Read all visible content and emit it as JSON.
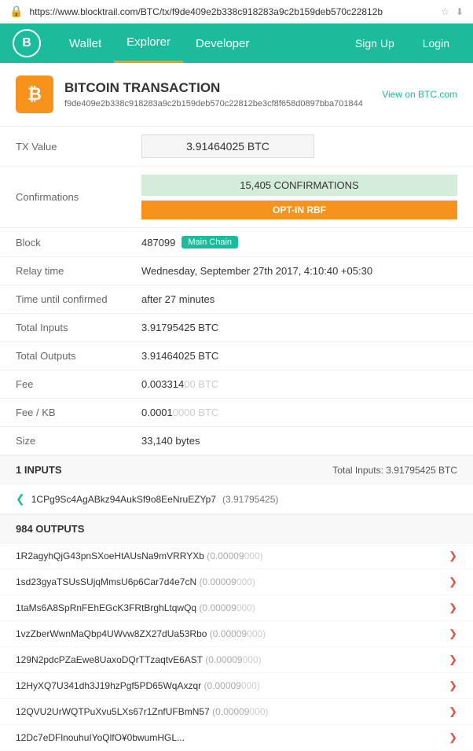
{
  "url": {
    "protocol_icon": "🔒",
    "address": "https://www.blocktrail.com/BTC/tx/f9de409e2b338c918283a9c2b159deb570c22812b"
  },
  "nav": {
    "logo": "B",
    "links": [
      {
        "label": "Wallet",
        "active": false
      },
      {
        "label": "Explorer",
        "active": true
      },
      {
        "label": "Developer",
        "active": false
      }
    ],
    "right_links": [
      {
        "label": "Sign Up"
      },
      {
        "label": "Login"
      }
    ]
  },
  "transaction": {
    "icon": "₿",
    "title": "BITCOIN TRANSACTION",
    "view_link_label": "View on BTC.com",
    "hash": "f9de409e2b338c918283a9c2b159deb570c22812be3cf8f658d0897bba701844"
  },
  "details": {
    "tx_value_label": "TX Value",
    "tx_value": "3.91464025 BTC",
    "confirmations_label": "Confirmations",
    "confirmations_value": "15,405 CONFIRMATIONS",
    "rbf_label": "OPT-IN RBF",
    "block_label": "Block",
    "block_number": "487099",
    "block_badge": "Main Chain",
    "relay_time_label": "Relay time",
    "relay_time_value": "Wednesday, September 27th 2017, 4:10:40 +05:30",
    "time_until_label": "Time until confirmed",
    "time_until_value": "after 27 minutes",
    "total_inputs_label": "Total Inputs",
    "total_inputs_value": "3.91795425 BTC",
    "total_outputs_label": "Total Outputs",
    "total_outputs_value": "3.91464025 BTC",
    "fee_label": "Fee",
    "fee_value": "0.003314",
    "fee_dim": "00 BTC",
    "fee_kb_label": "Fee / KB",
    "fee_kb_value": "0.0001",
    "fee_kb_dim": "0000 BTC",
    "size_label": "Size",
    "size_value": "33,140 bytes"
  },
  "inputs_section": {
    "label": "1 INPUTS",
    "total_label": "Total Inputs: 3.91795425 BTC",
    "items": [
      {
        "address": "1CPg9Sc4AgABkz94AukSf9o8EeNruEZYp7",
        "value": "(3.91795425)"
      }
    ]
  },
  "outputs_section": {
    "label": "984 OUTPUTS",
    "items": [
      {
        "address": "1R2agyhQjG43pnSXoeHtAUsNa9mVRRYXb",
        "value": "(0.00009",
        "dim": "000)"
      },
      {
        "address": "1sd23gyaTSUsSUjqMmsU6p6Car7d4e7cN",
        "value": "(0.00009",
        "dim": "000)"
      },
      {
        "address": "1taMs6A8SpRnFEhEGcK3FRtBrghLtqwQq",
        "value": "(0.00009",
        "dim": "000)"
      },
      {
        "address": "1vzZberWwnMaQbp4UWvw8ZX27dUa53Rbo",
        "value": "(0.00009",
        "dim": "000)"
      },
      {
        "address": "129N2pdcPZaEwe8UaxoDQrTTzaqtvE6AST",
        "value": "(0.00009",
        "dim": "000)"
      },
      {
        "address": "12HyXQ7U341dh3J19hzPgf5PD65WqAxzqr",
        "value": "(0.00009",
        "dim": "000)"
      },
      {
        "address": "12QVU2UrWQTPuXvu5LXs67r1ZnfUFBmN57",
        "value": "(0.00009",
        "dim": "000)"
      },
      {
        "address": "12Dc7eDFlnouhuIYoQlfO¥0bwumHGL...",
        "value": "",
        "dim": ""
      }
    ]
  }
}
